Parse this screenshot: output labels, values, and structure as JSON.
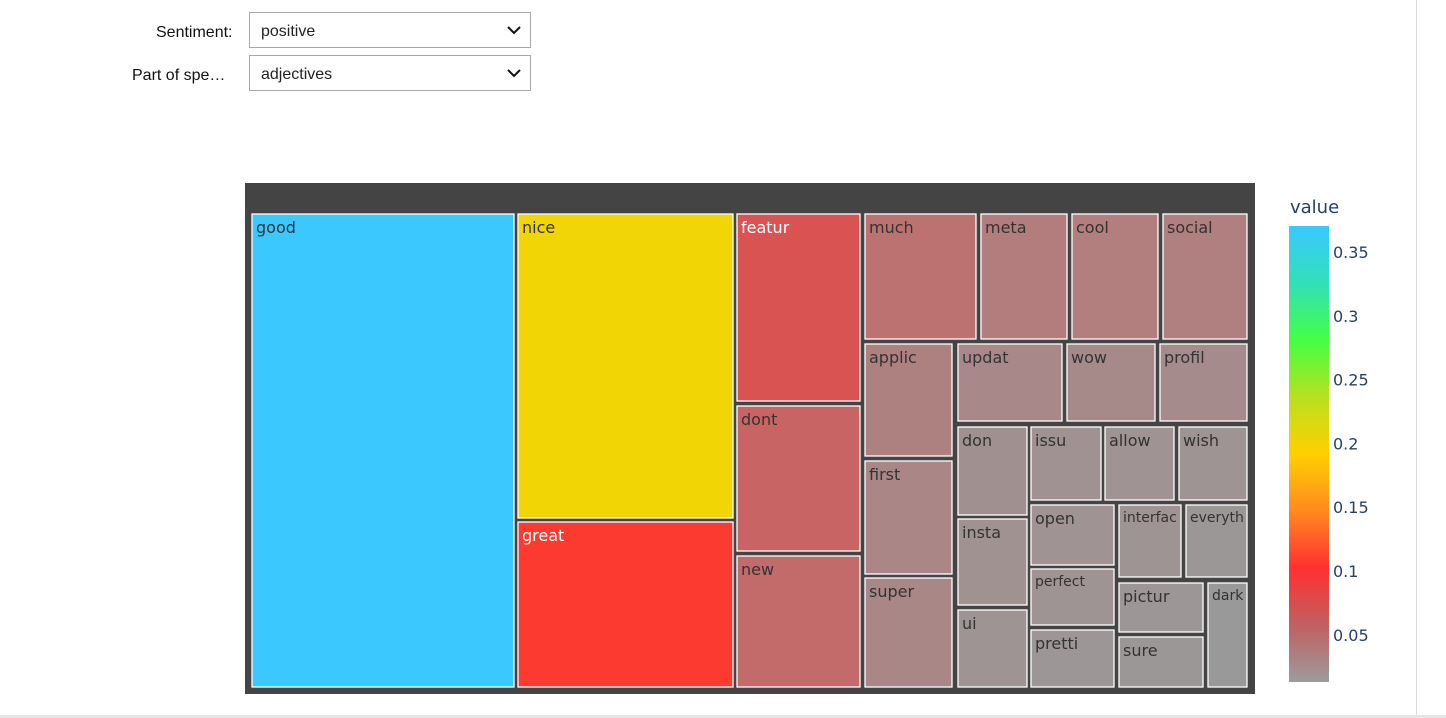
{
  "filters": {
    "sentiment_label": "Sentiment:",
    "sentiment_value": "positive",
    "pos_label": "Part of spe…",
    "pos_value": "adjectives"
  },
  "colorbar": {
    "title": "value",
    "ticks": [
      "0.35",
      "0.3",
      "0.25",
      "0.2",
      "0.15",
      "0.1",
      "0.05"
    ],
    "colorscale": [
      "#9c9c9c",
      "#c06060",
      "#ff3030",
      "#ff8a1e",
      "#ffd000",
      "#b8e020",
      "#44ff44",
      "#32e0b8",
      "#3ac8ff"
    ]
  },
  "chart_data": {
    "type": "treemap",
    "color_scale_label": "value",
    "color_range": [
      0.01,
      0.37
    ],
    "nodes": [
      {
        "label": "good",
        "value": 0.37,
        "color": "#3ac8ff"
      },
      {
        "label": "nice",
        "value": 0.19,
        "color": "#f2d505"
      },
      {
        "label": "great",
        "value": 0.11,
        "color": "#fd3a30"
      },
      {
        "label": "featur",
        "value": 0.07,
        "color": "#d95353"
      },
      {
        "label": "dont",
        "value": 0.06,
        "color": "#c96464"
      },
      {
        "label": "new",
        "value": 0.06,
        "color": "#c36a6a"
      },
      {
        "label": "much",
        "value": 0.05,
        "color": "#bd7272"
      },
      {
        "label": "meta",
        "value": 0.04,
        "color": "#b37d7d"
      },
      {
        "label": "cool",
        "value": 0.04,
        "color": "#b27e7e"
      },
      {
        "label": "social",
        "value": 0.04,
        "color": "#b07f7f"
      },
      {
        "label": "applic",
        "value": 0.04,
        "color": "#ae8181"
      },
      {
        "label": "updat",
        "value": 0.03,
        "color": "#a88888"
      },
      {
        "label": "wow",
        "value": 0.03,
        "color": "#a68a8a"
      },
      {
        "label": "profil",
        "value": 0.03,
        "color": "#a58b8b"
      },
      {
        "label": "first",
        "value": 0.03,
        "color": "#aa8686"
      },
      {
        "label": "don",
        "value": 0.02,
        "color": "#a19090"
      },
      {
        "label": "issu",
        "value": 0.02,
        "color": "#a09292"
      },
      {
        "label": "allow",
        "value": 0.02,
        "color": "#9f9393"
      },
      {
        "label": "wish",
        "value": 0.02,
        "color": "#9e9494"
      },
      {
        "label": "super",
        "value": 0.03,
        "color": "#a98787"
      },
      {
        "label": "insta",
        "value": 0.02,
        "color": "#a19292"
      },
      {
        "label": "open",
        "value": 0.02,
        "color": "#a09393"
      },
      {
        "label": "interfac",
        "value": 0.02,
        "color": "#9f9494"
      },
      {
        "label": "everyth",
        "value": 0.01,
        "color": "#9c9797"
      },
      {
        "label": "ui",
        "value": 0.02,
        "color": "#9f9494"
      },
      {
        "label": "perfect",
        "value": 0.02,
        "color": "#9f9494"
      },
      {
        "label": "pictur",
        "value": 0.01,
        "color": "#9d9696"
      },
      {
        "label": "dark",
        "value": 0.01,
        "color": "#999999"
      },
      {
        "label": "pretti",
        "value": 0.01,
        "color": "#9d9696"
      },
      {
        "label": "sure",
        "value": 0.01,
        "color": "#9c9797"
      }
    ]
  }
}
